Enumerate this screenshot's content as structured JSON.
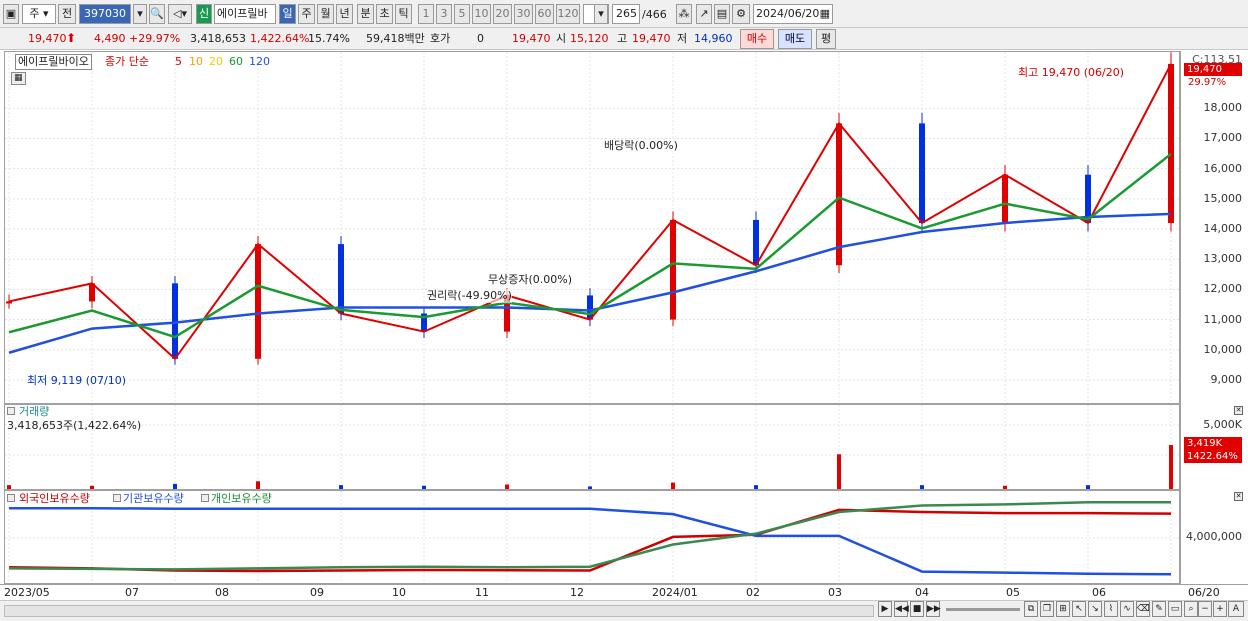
{
  "toolbar": {
    "type": "주",
    "prev_label": "전",
    "code": "397030",
    "info_icon": "i",
    "new_label": "신",
    "stock_name": "에이프릴바",
    "periods": [
      "일",
      "주",
      "월",
      "년",
      "분",
      "초",
      "틱"
    ],
    "minutes": [
      "1",
      "3",
      "5",
      "10",
      "20",
      "30",
      "60",
      "120"
    ],
    "count": "265",
    "total": "/466",
    "date": "2024/06/20"
  },
  "quote": {
    "price": "19,470",
    "change": "4,490",
    "rate": "+29.97%",
    "volume": "3,418,653",
    "vol_rate": "1,422.64%",
    "turnover": "15.74%",
    "amount": "59,418백만",
    "hoga_label": "호가",
    "hoga": "0",
    "hoga_price": "19,470",
    "open_label": "시",
    "open": "15,120",
    "high_label": "고",
    "high": "19,470",
    "low_label": "저",
    "low": "14,960",
    "buy": "매수",
    "sell": "매도",
    "avg": "평"
  },
  "price_panel": {
    "name": "에이프릴바이오",
    "ma_label": "종가 단순",
    "ma_periods": [
      "5",
      "10",
      "20",
      "60",
      "120"
    ],
    "annotations": {
      "high": "최고 19,470 (06/20)",
      "low": "최저 9,119 (07/10)",
      "dividend": "배당락(0.00%)",
      "bonus": "무상증자(0.00%)",
      "rights": "권리락(-49.90%)"
    },
    "cur_label": "C:113.51",
    "cur_price": "19,470",
    "cur_rate": "29.97%",
    "y_ticks": [
      "18,000",
      "17,000",
      "16,000",
      "15,000",
      "14,000",
      "13,000",
      "12,000",
      "11,000",
      "10,000",
      "9,000"
    ]
  },
  "volume_panel": {
    "title": "거래량",
    "value": "3,418,653주(1,422.64%)",
    "tick": "5,000K",
    "tag": "3,419K",
    "tag_rate": "1422.64%"
  },
  "holding_panel": {
    "series": [
      "외국인보유수량",
      "기관보유수량",
      "개인보유수량"
    ],
    "tick": "4,000,000"
  },
  "x_labels": [
    "2023/05",
    "07",
    "08",
    "09",
    "10",
    "11",
    "12",
    "2024/01",
    "02",
    "03",
    "04",
    "05",
    "06",
    "06/20"
  ],
  "colors": {
    "up": "#e00000",
    "down": "#0030e0",
    "ma5": "#e00000",
    "ma10": "#ff9a00",
    "ma20": "#f0e000",
    "ma60": "#1a9a30",
    "ma120": "#2050e0"
  },
  "chart_data": {
    "type": "candlestick",
    "x": [
      "2023/05",
      "2023/06",
      "2023/07",
      "2023/08",
      "2023/09",
      "2023/10",
      "2023/11",
      "2023/12",
      "2024/01",
      "2024/02",
      "2024/03",
      "2024/04",
      "2024/05",
      "2024/06",
      "2024/06/20"
    ],
    "close": [
      11600,
      12200,
      9700,
      13500,
      11200,
      10600,
      11800,
      11000,
      14300,
      12800,
      17500,
      14200,
      15800,
      14200,
      19470
    ],
    "ma120": [
      9900,
      10700,
      10900,
      11200,
      11400,
      11400,
      11400,
      11300,
      11900,
      12600,
      13400,
      13900,
      14200,
      14400,
      14500
    ],
    "volume_k": [
      300,
      250,
      400,
      600,
      300,
      250,
      350,
      200,
      500,
      300,
      2700,
      300,
      250,
      300,
      3419
    ],
    "foreign": [
      900000,
      800000,
      600000,
      550000,
      600000,
      650000,
      620000,
      600000,
      3700000,
      3900000,
      6200000,
      6000000,
      5900000,
      5900000,
      5850000
    ],
    "institution": [
      6350000,
      6350000,
      6300000,
      6300000,
      6300000,
      6300000,
      6300000,
      6300000,
      5800000,
      3800000,
      3800000,
      500000,
      400000,
      300000,
      250000
    ],
    "individual": [
      800000,
      750000,
      700000,
      800000,
      900000,
      950000,
      900000,
      950000,
      3000000,
      4000000,
      6000000,
      6600000,
      6700000,
      6900000,
      6900000
    ]
  }
}
